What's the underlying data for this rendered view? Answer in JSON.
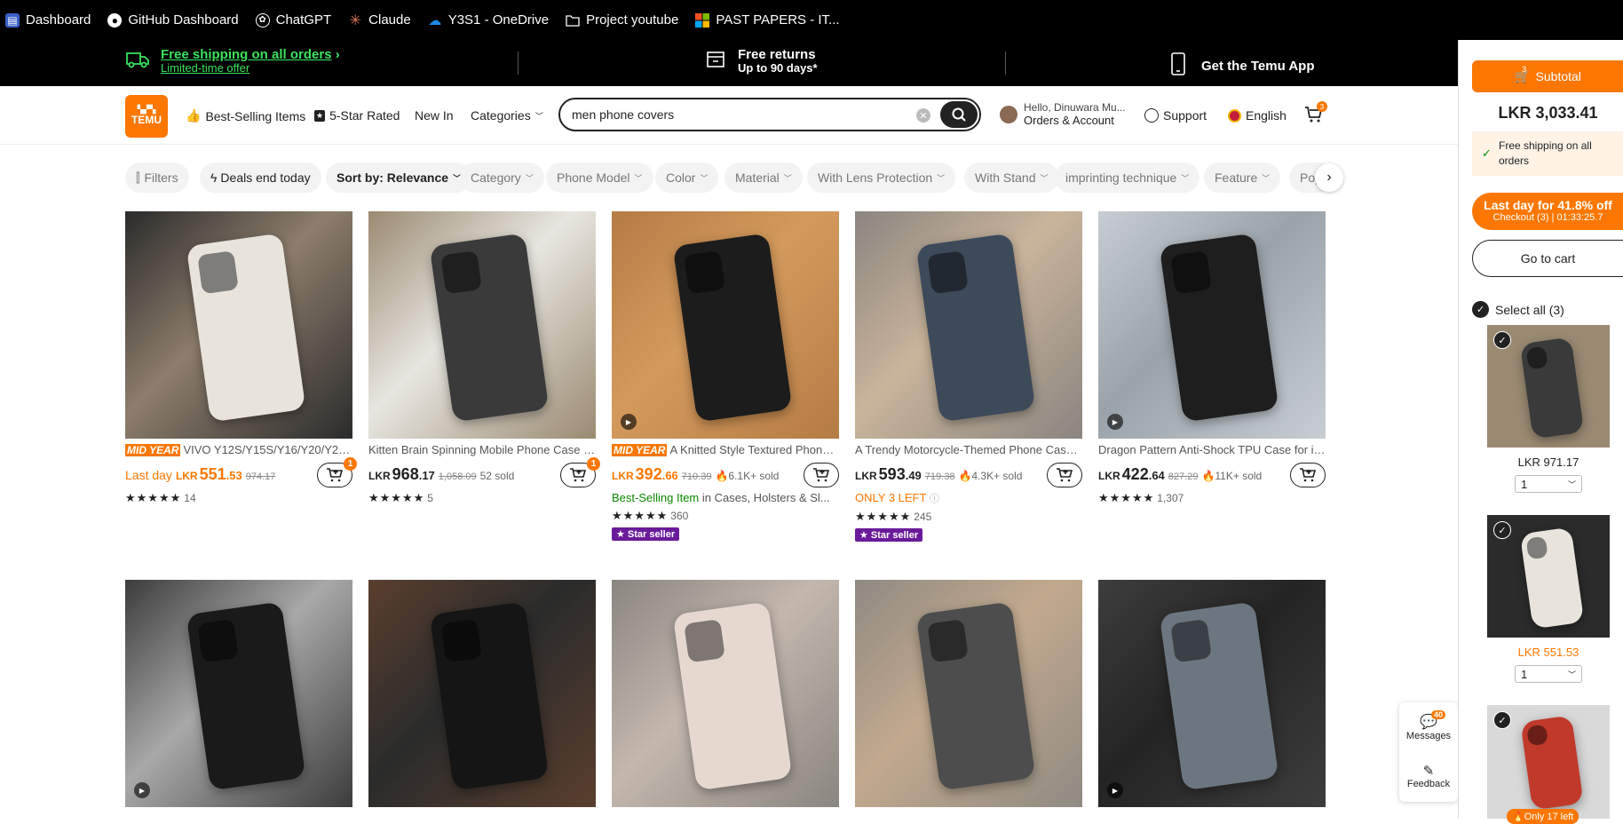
{
  "bookmarks": [
    {
      "label": "Dashboard",
      "icon": "dashboard-icon"
    },
    {
      "label": "GitHub Dashboard",
      "icon": "github-icon"
    },
    {
      "label": "ChatGPT",
      "icon": "chatgpt-icon"
    },
    {
      "label": "Claude",
      "icon": "claude-icon"
    },
    {
      "label": "Y3S1 - OneDrive",
      "icon": "onedrive-icon"
    },
    {
      "label": "Project youtube",
      "icon": "folder-icon"
    },
    {
      "label": "PAST PAPERS - IT...",
      "icon": "microsoft-icon"
    }
  ],
  "promo": {
    "shipping_title": "Free shipping on all orders",
    "shipping_sub": "Limited-time offer",
    "returns_title": "Free returns",
    "returns_sub": "Up to 90 days*",
    "app": "Get the Temu App"
  },
  "header": {
    "logo_text": "TEMU",
    "best_selling": "Best-Selling Items",
    "five_star": "5-Star Rated",
    "new_in": "New In",
    "categories": "Categories",
    "search_value": "men phone covers",
    "account_greeting": "Hello, Dinuwara Mu...",
    "account_label": "Orders & Account",
    "support": "Support",
    "language": "English",
    "cart_count": "3"
  },
  "filters": [
    "Filters",
    "Deals end today",
    "Sort by: Relevance",
    "Category",
    "Phone Model",
    "Color",
    "Material",
    "With Lens Protection",
    "With Stand",
    "imprinting technique",
    "Feature",
    "Popu"
  ],
  "products": [
    {
      "midyear": "MID YEAR",
      "title": "VIVO Y12S/Y15S/Y16/Y20/Y21/...",
      "prefix": "Last day",
      "currency": "LKR",
      "price_int": "551",
      "price_dec": ".53",
      "old": "974.17",
      "sold": "",
      "stars": "★★★★★",
      "reviews": "14",
      "cart_badge": "1",
      "colors": [
        "#2b2b2b",
        "#e8e4dc",
        "#8d7d6c"
      ]
    },
    {
      "midyear": "",
      "title": "Kitten Brain Spinning Mobile Phone Case S...",
      "prefix": "",
      "currency": "LKR",
      "price_int": "968",
      "price_dec": ".17",
      "old": "1,058.09",
      "sold": "52 sold",
      "stars": "★★★★★",
      "reviews": "5",
      "cart_badge": "1",
      "colors": [
        "#9a8a72",
        "#3a3a3a",
        "#e8e6e0"
      ]
    },
    {
      "midyear": "MID YEAR",
      "title": "A Knitted Style Textured Phone ...",
      "prefix": "",
      "currency": "LKR",
      "price_int": "392",
      "price_dec": ".66",
      "old": "710.39",
      "sold": "🔥6.1K+ sold",
      "stars": "★★★★★",
      "reviews": "360",
      "cart_badge": "",
      "best": "Best-Selling Item",
      "best_tail": " in Cases, Holsters & Sl...",
      "star_seller": "Star seller",
      "colors": [
        "#b57b44",
        "#1c1c1c",
        "#d49a5c"
      ]
    },
    {
      "midyear": "",
      "title": "A Trendy Motorcycle-Themed Phone Case,...",
      "prefix": "",
      "currency": "LKR",
      "price_int": "593",
      "price_dec": ".49",
      "old": "719.38",
      "sold": "🔥4.3K+ sold",
      "stars": "★★★★★",
      "reviews": "245",
      "cart_badge": "",
      "only_left": "ONLY 3 LEFT",
      "star_seller": "Star seller",
      "colors": [
        "#8b8580",
        "#3d4a5a",
        "#c9b49b"
      ]
    },
    {
      "midyear": "",
      "title": "Dragon Pattern Anti-Shock TPU Case for iP...",
      "prefix": "",
      "currency": "LKR",
      "price_int": "422",
      "price_dec": ".64",
      "old": "827.29",
      "sold": "🔥11K+ sold",
      "stars": "★★★★★",
      "reviews": "1,307",
      "cart_badge": "",
      "colors": [
        "#c7cdd2",
        "#1e1e1e",
        "#9aa3aa"
      ]
    },
    {
      "colors": [
        "#3c3c3c",
        "#1a1a1a",
        "#a8a8a8"
      ]
    },
    {
      "colors": [
        "#5a3f2e",
        "#151515",
        "#2b2b2b"
      ]
    },
    {
      "colors": [
        "#8a8680",
        "#e6d8cf",
        "#c4b7ad"
      ]
    },
    {
      "colors": [
        "#8f8a82",
        "#4d4d4d",
        "#c2a98e"
      ]
    },
    {
      "colors": [
        "#3d3d3d",
        "#6b7680",
        "#242424"
      ]
    }
  ],
  "sidebar": {
    "subtotal_label": "Subtotal",
    "cart_count": "3",
    "amount": "LKR 3,033.41",
    "free_ship": "Free shipping on all orders",
    "lastday_title": "Last day for 41.8% off",
    "lastday_sub": "Checkout (3) | 01:33:25.7",
    "go_to_cart": "Go to cart",
    "select_all": "Select all (3)",
    "items": [
      {
        "price": "LKR 971.17",
        "qty": "1",
        "colors": [
          "#9a8a72",
          "#3a3a3a"
        ]
      },
      {
        "price": "LKR 551.53",
        "qty": "1",
        "colors": [
          "#2b2b2b",
          "#e8e4dc"
        ]
      },
      {
        "only_left": "Only 17 left",
        "colors": [
          "#d9d9d9",
          "#c0392b"
        ]
      }
    ]
  },
  "floating": {
    "messages": "Messages",
    "messages_count": "40",
    "feedback": "Feedback"
  }
}
